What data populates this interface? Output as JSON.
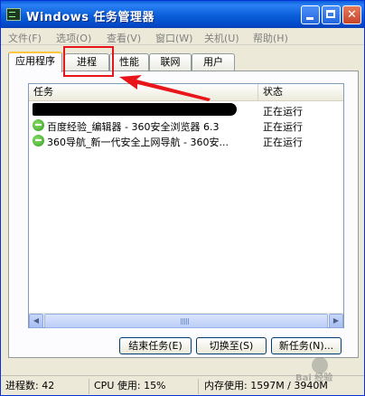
{
  "window": {
    "title": "Windows 任务管理器",
    "controls": {
      "min_icon": "minimize-icon",
      "max_icon": "maximize-icon",
      "close_icon": "close-icon",
      "close_glyph": "✕"
    },
    "accent_color": "#0a5ed8"
  },
  "menu": {
    "items": [
      "文件(F)",
      "选项(O)",
      "查看(V)",
      "窗口(W)",
      "关机(U)",
      "帮助(H)"
    ]
  },
  "tabs": {
    "items": [
      "应用程序",
      "进程",
      "性能",
      "联网",
      "用户"
    ],
    "active": "应用程序",
    "highlighted": "进程"
  },
  "list": {
    "columns": {
      "task": "任务",
      "status": "状态"
    },
    "rows": [
      {
        "task": "",
        "status": "正在运行",
        "redacted": true
      },
      {
        "task": "百度经验_编辑器 - 360安全浏览器 6.3",
        "status": "正在运行",
        "icon": "browser-360-icon"
      },
      {
        "task": "360导航_新一代安全上网导航 - 360安...",
        "status": "正在运行",
        "icon": "browser-360-icon"
      }
    ],
    "scroll_left": "◀",
    "scroll_right": "▶"
  },
  "buttons": {
    "end_task": "结束任务(E)",
    "switch_to": "切换至(S)",
    "new_task": "新任务(N)..."
  },
  "statusbar": {
    "processes": "进程数: 42",
    "cpu": "CPU 使用: 15%",
    "memory": "内存使用: 1597M / 3940M"
  },
  "watermark": {
    "text": "Bai 经验"
  },
  "annotation_color": "#e8161b"
}
